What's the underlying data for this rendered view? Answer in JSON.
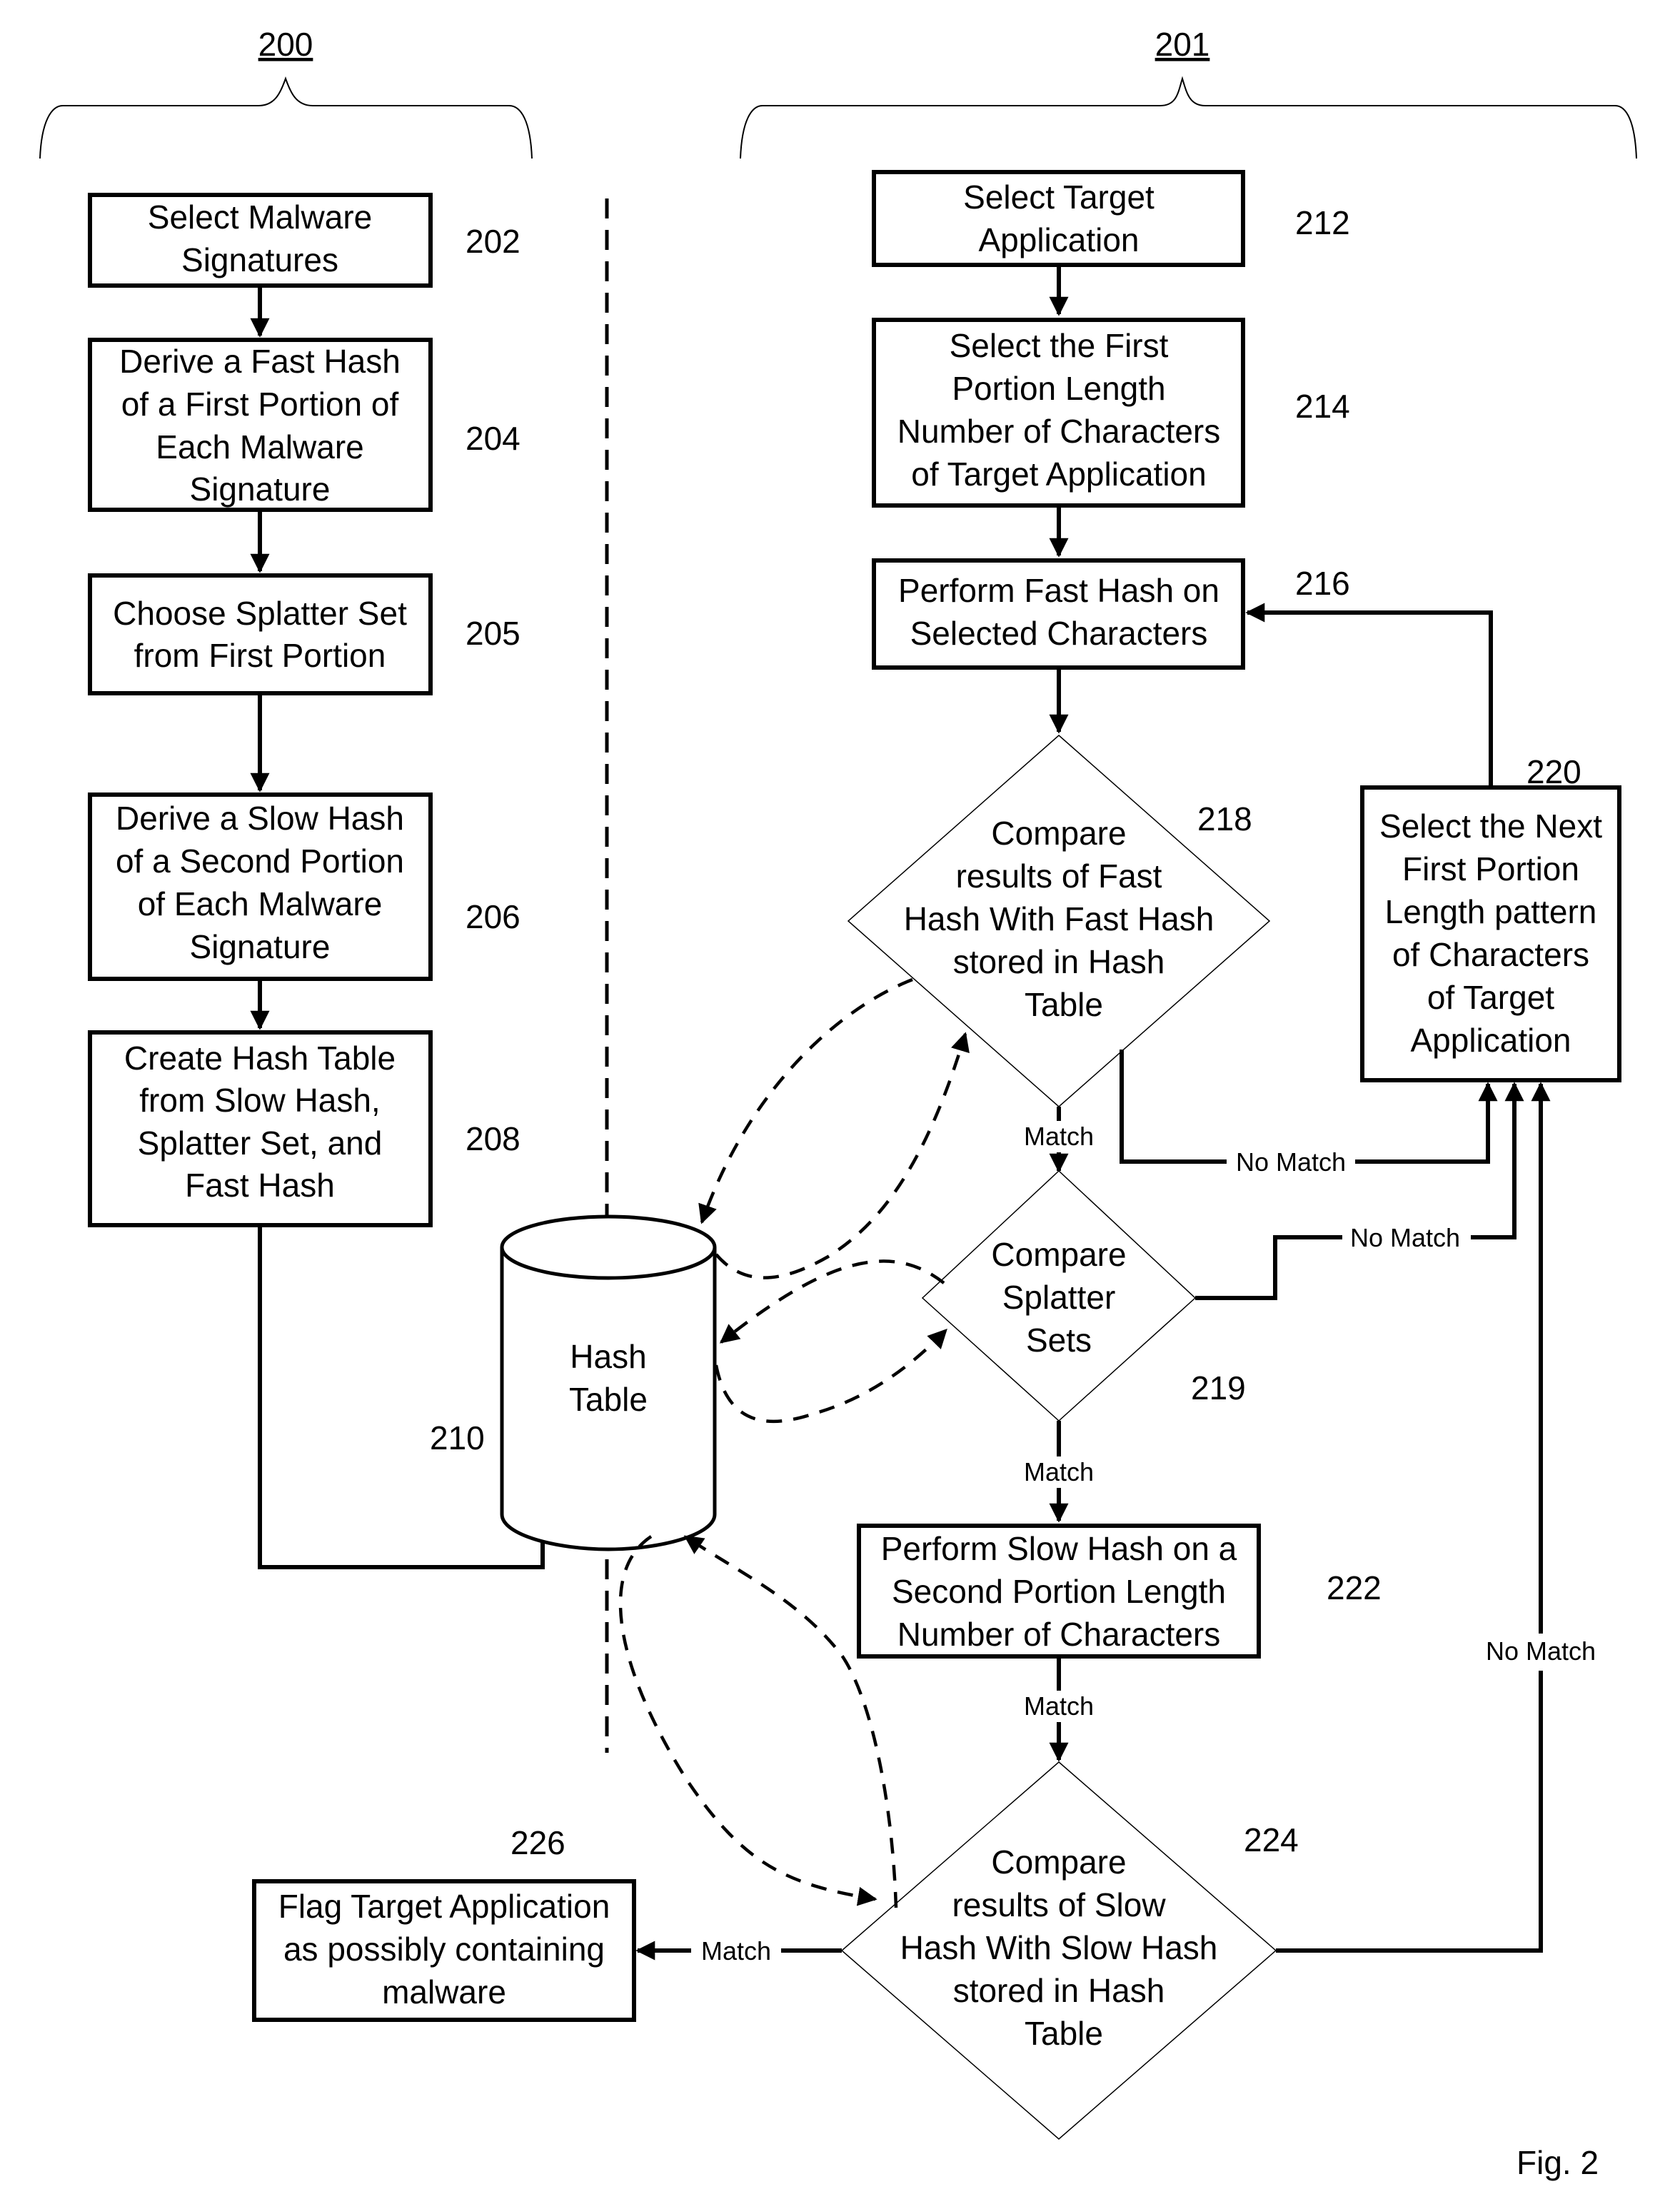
{
  "figure_label": "Fig. 2",
  "groups": {
    "left": {
      "ref": "200"
    },
    "right": {
      "ref": "201"
    }
  },
  "left_steps": [
    {
      "ref": "202",
      "lines": [
        "Select Malware",
        "Signatures"
      ]
    },
    {
      "ref": "204",
      "lines": [
        "Derive a Fast Hash",
        "of a First Portion of",
        "Each Malware",
        "Signature"
      ]
    },
    {
      "ref": "205",
      "lines": [
        "Choose Splatter Set",
        "from First Portion"
      ]
    },
    {
      "ref": "206",
      "lines": [
        "Derive a Slow Hash",
        "of a Second Portion",
        "of Each Malware",
        "Signature"
      ]
    },
    {
      "ref": "208",
      "lines": [
        "Create Hash Table",
        "from Slow Hash,",
        "Splatter Set, and",
        "Fast Hash"
      ]
    }
  ],
  "hash_table": {
    "ref": "210",
    "lines": [
      "Hash",
      "Table"
    ]
  },
  "right_steps": {
    "s212": {
      "ref": "212",
      "lines": [
        "Select Target",
        "Application"
      ]
    },
    "s214": {
      "ref": "214",
      "lines": [
        "Select the First",
        "Portion Length",
        "Number of Characters",
        "of Target Application"
      ]
    },
    "s216": {
      "ref": "216",
      "lines": [
        "Perform Fast Hash on",
        "Selected Characters"
      ]
    },
    "s218": {
      "ref": "218",
      "lines": [
        "Compare",
        "results of Fast",
        "Hash With Fast Hash",
        "stored in Hash",
        "Table"
      ]
    },
    "s219": {
      "ref": "219",
      "lines": [
        "Compare",
        "Splatter",
        "Sets"
      ]
    },
    "s220": {
      "ref": "220",
      "lines": [
        "Select the Next",
        "First Portion",
        "Length pattern",
        "of Characters",
        "of Target",
        "Application"
      ]
    },
    "s222": {
      "ref": "222",
      "lines": [
        "Perform Slow Hash on a",
        "Second Portion Length",
        "Number of Characters"
      ]
    },
    "s224": {
      "ref": "224",
      "lines": [
        "Compare",
        "results of Slow",
        "Hash With Slow Hash",
        "stored in Hash",
        "Table"
      ]
    },
    "s226": {
      "ref": "226",
      "lines": [
        "Flag Target Application",
        "as possibly containing",
        "malware"
      ]
    }
  },
  "edge_labels": {
    "match_218": "Match",
    "no_match_218": "No Match",
    "no_match_219": "No Match",
    "match_219": "Match",
    "match_222": "Match",
    "no_match_224": "No Match",
    "match_224": "Match"
  }
}
